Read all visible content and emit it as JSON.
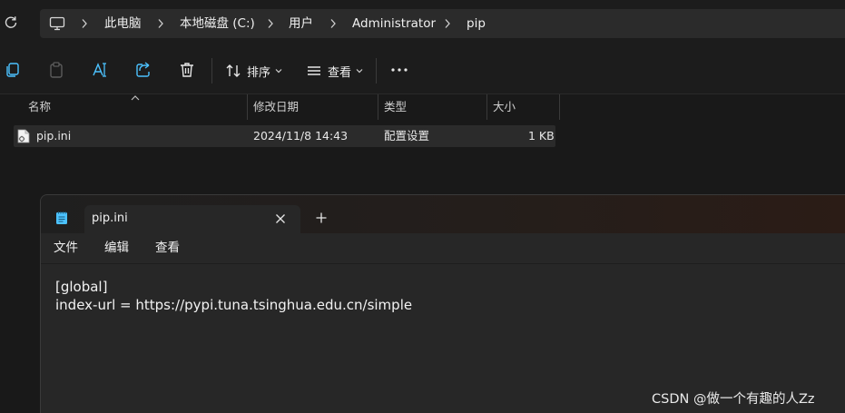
{
  "address_bar": {
    "breadcrumbs": [
      "此电脑",
      "本地磁盘 (C:)",
      "用户",
      "Administrator",
      "pip"
    ]
  },
  "toolbar": {
    "sort_label": "排序",
    "view_label": "查看"
  },
  "file_list": {
    "columns": [
      "名称",
      "修改日期",
      "类型",
      "大小"
    ],
    "rows": [
      {
        "name": "pip.ini",
        "modified": "2024/11/8 14:43",
        "type": "配置设置",
        "size": "1 KB"
      }
    ]
  },
  "notepad": {
    "tab_title": "pip.ini",
    "menu": [
      "文件",
      "编辑",
      "查看"
    ],
    "content_lines": [
      "[global]",
      "index-url = https://pypi.tuna.tsinghua.edu.cn/simple"
    ]
  },
  "watermark": "CSDN @做一个有趣的人Zz",
  "colors": {
    "explorer_bg": "#191919",
    "address_bg": "#2b2b2b",
    "row_selected_bg": "#2b2b2b",
    "notepad_bg": "#272727",
    "accent_blue": "#4cc2ff"
  }
}
